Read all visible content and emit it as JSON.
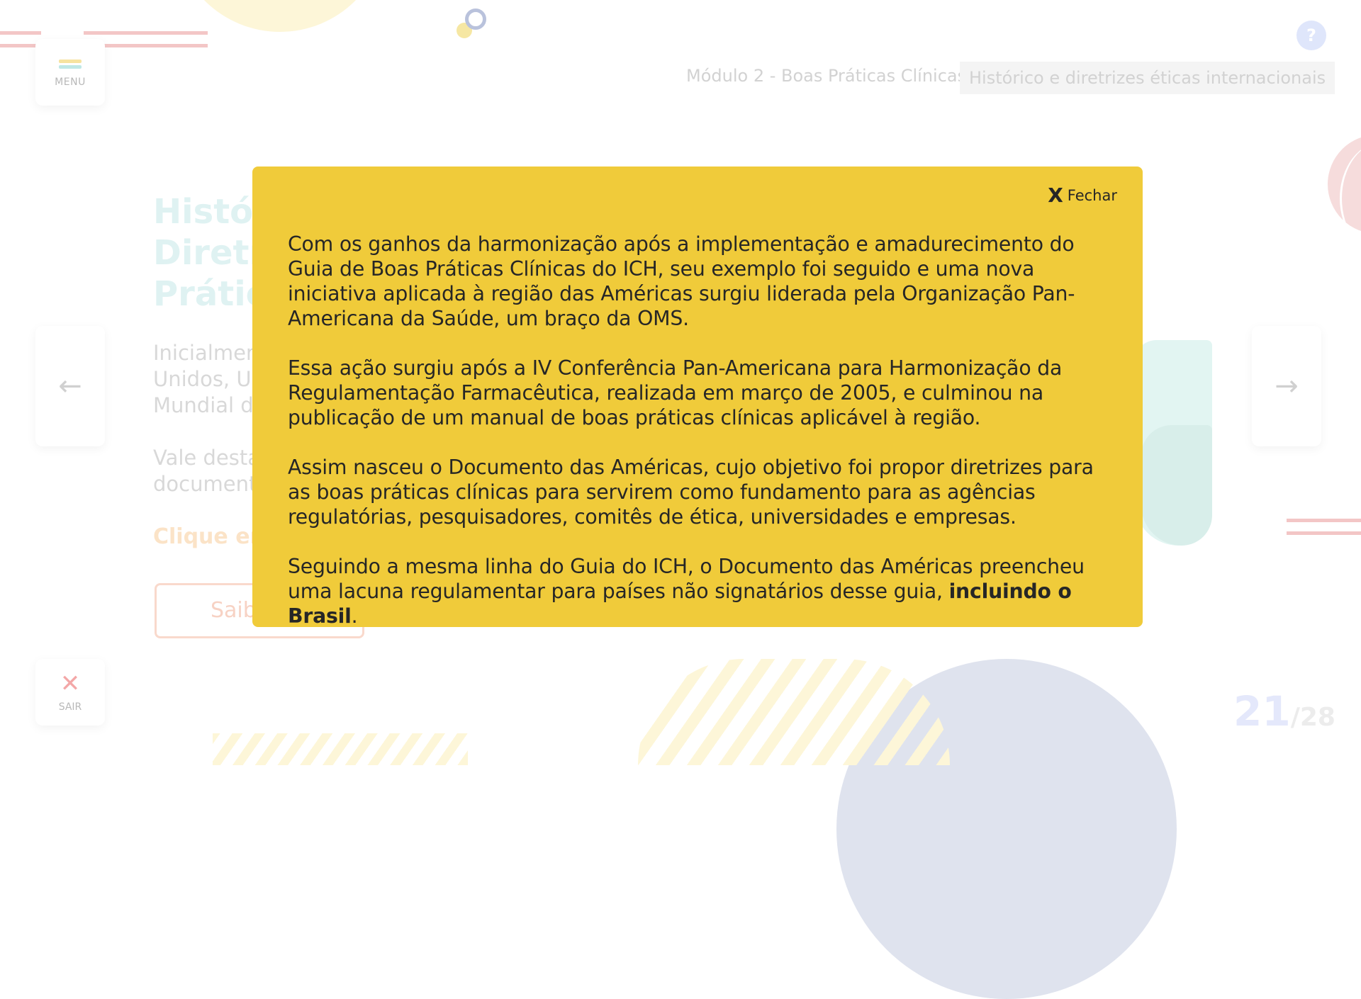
{
  "header": {
    "menu_label": "MENU",
    "help_label": "?",
    "module": "Módulo 2 - Boas Práticas Clínicas",
    "topic": "Histórico e diretrizes éticas internacionais"
  },
  "slide": {
    "title_lines": [
      "Histór",
      "Diretr",
      "Prátic"
    ],
    "paragraph1_lines": [
      "Inicialmen",
      "Unidos, U",
      "Mundial d"
    ],
    "paragraph2_lines": [
      "Vale desta",
      "document"
    ],
    "link_text": "Clique em",
    "button_label": "Saib"
  },
  "navigation": {
    "prev_icon": "←",
    "next_icon": "→",
    "exit_label": "SAIR",
    "exit_icon": "✕"
  },
  "pagination": {
    "current": "21",
    "total": "/28"
  },
  "modal": {
    "close_icon": "X",
    "close_label": "Fechar",
    "paragraph1": "Com os ganhos da harmonização após a implementação e amadurecimento do Guia de Boas Práticas Clínicas do ICH, seu exemplo foi seguido e uma nova iniciativa aplicada à região das Américas surgiu liderada pela Organização Pan-Americana da Saúde, um braço da OMS.",
    "paragraph2": "Essa ação surgiu após a IV Conferência Pan-Americana para Harmonização da Regulamentação Farmacêutica, realizada em março de 2005, e culminou na publicação de um manual de boas práticas clínicas aplicável à região.",
    "paragraph3": "Assim nasceu o Documento das Américas, cujo objetivo foi propor diretrizes para as boas práticas clínicas para servirem como fundamento para as agências regulatórias, pesquisadores, comitês de ética, universidades e empresas.",
    "paragraph4_start": "Seguindo a mesma linha do Guia do ICH, o Documento das Américas preencheu uma lacuna regulamentar para países não signatários desse guia, ",
    "paragraph4_bold": "incluindo o Brasil",
    "paragraph4_end": "."
  },
  "colors": {
    "modal_background": "#f0cb3a",
    "accent_blue": "#dfe6fb",
    "accent_red": "#f3a7a7"
  }
}
